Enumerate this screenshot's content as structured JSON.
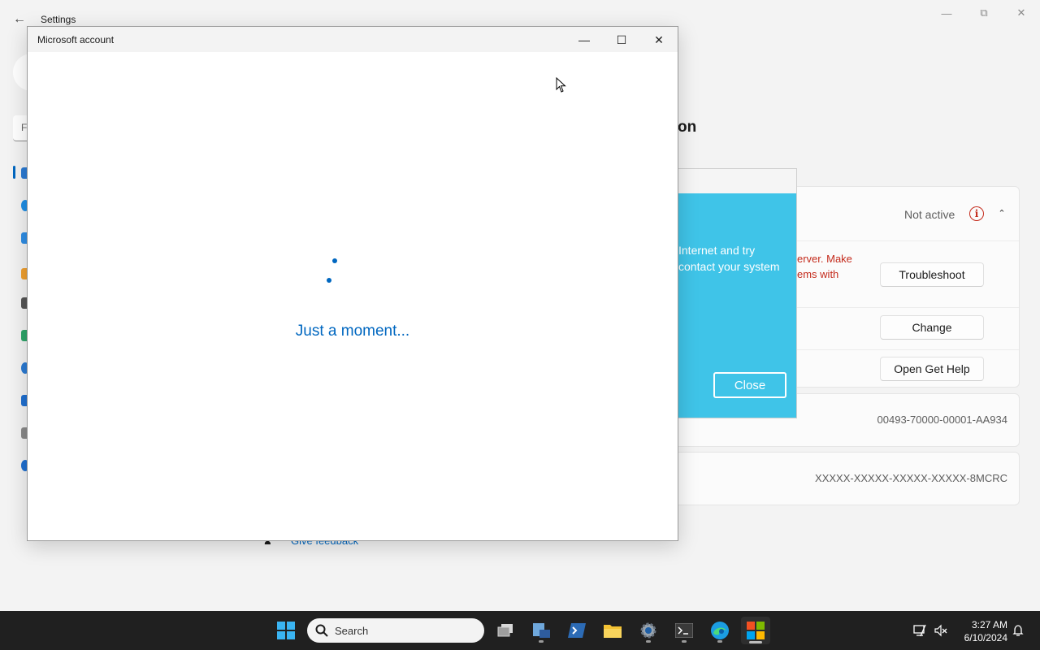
{
  "settings": {
    "title": "Settings",
    "search_placeholder": "F",
    "heading_fragment": "on",
    "activation_state": "Not active",
    "error_text": "erver. Make\nems with",
    "buttons": {
      "troubleshoot": "Troubleshoot",
      "change": "Change",
      "get_help": "Open Get Help"
    },
    "product_id": "00493-70000-00001-AA934",
    "product_key": "XXXXX-XXXXX-XXXXX-XXXXX-8MCRC",
    "feedback_link": "Give feedback"
  },
  "dialog_behind": {
    "text": "Internet and try\ncontact your system",
    "close_label": "Close",
    "accent": "#3fc4e8"
  },
  "msa_window": {
    "title": "Microsoft account",
    "message": "Just a moment...",
    "accent": "#0067c0"
  },
  "taskbar": {
    "search_label": "Search",
    "apps": [
      "start-icon",
      "task-view-icon",
      "server-manager-icon",
      "powershell-icon",
      "file-explorer-icon",
      "settings-gear-icon",
      "terminal-icon",
      "edge-icon",
      "store-icon"
    ],
    "time": "3:27 AM",
    "date": "6/10/2024"
  }
}
